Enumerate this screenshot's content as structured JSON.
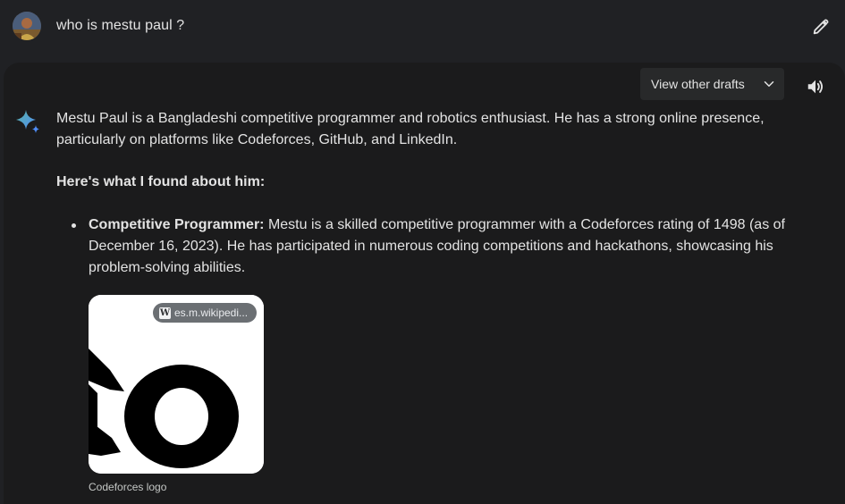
{
  "prompt": {
    "text": "who is mestu paul ?"
  },
  "response": {
    "view_drafts_label": "View other drafts",
    "intro": "Mestu Paul is a Bangladeshi competitive programmer and robotics enthusiast. He has a strong online presence, particularly on platforms like Codeforces, GitHub, and LinkedIn.",
    "heading": "Here's what I found about him:",
    "bullets": [
      {
        "title": "Competitive Programmer:",
        "text": " Mestu is a skilled competitive programmer with a Codeforces rating of 1498 (as of December 16, 2023). He has participated in numerous coding competitions and hackathons, showcasing his problem-solving abilities."
      }
    ],
    "image": {
      "source": "es.m.wikipedi...",
      "caption": "Codeforces logo"
    }
  },
  "icons": {
    "edit": "pencil-icon",
    "speaker": "speaker-icon",
    "chevron": "chevron-down-icon",
    "assistant": "sparkle-icon",
    "source": "wikipedia-icon"
  },
  "colors": {
    "background": "#202124",
    "card": "#1b1b1c",
    "text": "#e3e3e3",
    "drafts_button": "#28292a",
    "sparkle_blue": "#4f8df7",
    "sparkle_teal": "#5bb6a6"
  }
}
